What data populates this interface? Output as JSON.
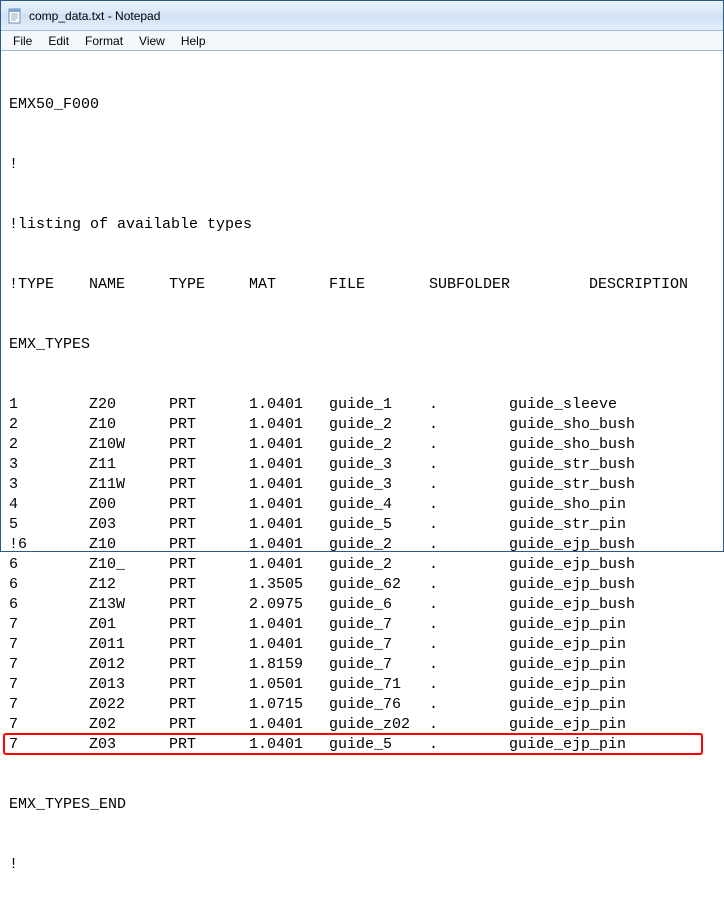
{
  "window": {
    "title": "comp_data.txt - Notepad"
  },
  "menu": {
    "file": "File",
    "edit": "Edit",
    "format": "Format",
    "view": "View",
    "help": "Help"
  },
  "content": {
    "line1": "EMX50_F000",
    "line2": "!",
    "line3": "!listing of available types",
    "hdr": {
      "type": "!TYPE",
      "name": "NAME",
      "type2": "TYPE",
      "mat": "MAT",
      "file": "FILE",
      "sub": "SUBFOLDER",
      "desc": "DESCRIPTION"
    },
    "section_start": "EMX_TYPES",
    "rows": [
      {
        "type": "1",
        "name": "Z20",
        "type2": "PRT",
        "mat": "1.0401",
        "file": "guide_1",
        "sub": ".",
        "desc": "guide_sleeve"
      },
      {
        "type": "2",
        "name": "Z10",
        "type2": "PRT",
        "mat": "1.0401",
        "file": "guide_2",
        "sub": ".",
        "desc": "guide_sho_bush"
      },
      {
        "type": "2",
        "name": "Z10W",
        "type2": "PRT",
        "mat": "1.0401",
        "file": "guide_2",
        "sub": ".",
        "desc": "guide_sho_bush"
      },
      {
        "type": "3",
        "name": "Z11",
        "type2": "PRT",
        "mat": "1.0401",
        "file": "guide_3",
        "sub": ".",
        "desc": "guide_str_bush"
      },
      {
        "type": "3",
        "name": "Z11W",
        "type2": "PRT",
        "mat": "1.0401",
        "file": "guide_3",
        "sub": ".",
        "desc": "guide_str_bush"
      },
      {
        "type": "4",
        "name": "Z00",
        "type2": "PRT",
        "mat": "1.0401",
        "file": "guide_4",
        "sub": ".",
        "desc": "guide_sho_pin"
      },
      {
        "type": "5",
        "name": "Z03",
        "type2": "PRT",
        "mat": "1.0401",
        "file": "guide_5",
        "sub": ".",
        "desc": "guide_str_pin"
      },
      {
        "type": "!6",
        "name": "Z10",
        "type2": "PRT",
        "mat": "1.0401",
        "file": "guide_2",
        "sub": ".",
        "desc": "guide_ejp_bush"
      },
      {
        "type": "6",
        "name": "Z10_",
        "type2": "PRT",
        "mat": "1.0401",
        "file": "guide_2",
        "sub": ".",
        "desc": "guide_ejp_bush"
      },
      {
        "type": "6",
        "name": "Z12",
        "type2": "PRT",
        "mat": "1.3505",
        "file": "guide_62",
        "sub": ".",
        "desc": "guide_ejp_bush"
      },
      {
        "type": "6",
        "name": "Z13W",
        "type2": "PRT",
        "mat": "2.0975",
        "file": "guide_6",
        "sub": ".",
        "desc": "guide_ejp_bush"
      },
      {
        "type": "7",
        "name": "Z01",
        "type2": "PRT",
        "mat": "1.0401",
        "file": "guide_7",
        "sub": ".",
        "desc": "guide_ejp_pin"
      },
      {
        "type": "7",
        "name": "Z011",
        "type2": "PRT",
        "mat": "1.0401",
        "file": "guide_7",
        "sub": ".",
        "desc": "guide_ejp_pin"
      },
      {
        "type": "7",
        "name": "Z012",
        "type2": "PRT",
        "mat": "1.8159",
        "file": "guide_7",
        "sub": ".",
        "desc": "guide_ejp_pin"
      },
      {
        "type": "7",
        "name": "Z013",
        "type2": "PRT",
        "mat": "1.0501",
        "file": "guide_71",
        "sub": ".",
        "desc": "guide_ejp_pin"
      },
      {
        "type": "7",
        "name": "Z022",
        "type2": "PRT",
        "mat": "1.0715",
        "file": "guide_76",
        "sub": ".",
        "desc": "guide_ejp_pin"
      },
      {
        "type": "7",
        "name": "Z02",
        "type2": "PRT",
        "mat": "1.0401",
        "file": "guide_z02",
        "sub": ".",
        "desc": "guide_ejp_pin"
      },
      {
        "type": "7",
        "name": "Z03",
        "type2": "PRT",
        "mat": "1.0401",
        "file": "guide_5",
        "sub": ".",
        "desc": "guide_ejp_pin"
      }
    ],
    "section_end": "EMX_TYPES_END",
    "line_last": "!"
  },
  "highlight_row_index": 17
}
